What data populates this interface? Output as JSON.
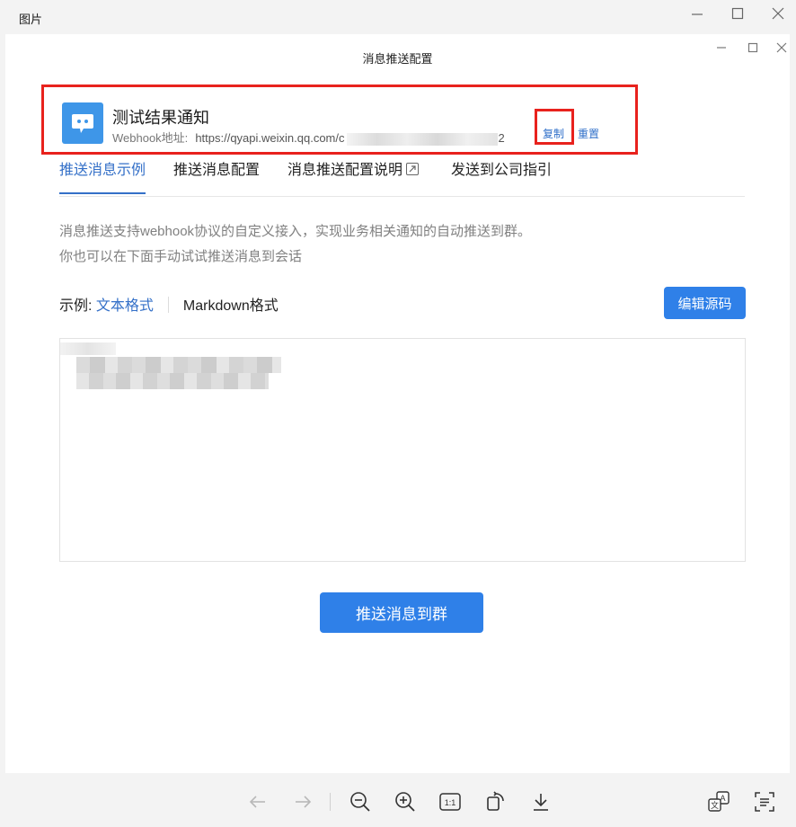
{
  "viewer": {
    "title": "图片",
    "controls": [
      "minimize-icon",
      "maximize-icon",
      "close-icon"
    ]
  },
  "dialog": {
    "title": "消息推送配置",
    "controls": [
      "minimize-icon",
      "maximize-icon",
      "close-icon"
    ]
  },
  "bot": {
    "name": "测试结果通知",
    "webhook_label": "Webhook地址:",
    "webhook_url_prefix": "https://qyapi.weixin.qq.com/c",
    "webhook_url_suffix": "2",
    "copy_label": "复制",
    "reset_label": "重置"
  },
  "tabs": [
    {
      "label": "推送消息示例",
      "active": true
    },
    {
      "label": "推送消息配置",
      "active": false
    },
    {
      "label": "消息推送配置说明",
      "active": false
    },
    {
      "label": "发送到公司指引",
      "active": false
    }
  ],
  "description": {
    "line1": "消息推送支持webhook协议的自定义接入，实现业务相关通知的自动推送到群。",
    "line2": "你也可以在下面手动试试推送消息到会话"
  },
  "example": {
    "label": "示例:",
    "options": [
      "文本格式",
      "Markdown格式"
    ],
    "selected": "文本格式"
  },
  "edit_source_label": "编辑源码",
  "push_button_label": "推送消息到群",
  "colors": {
    "accent": "#2f80e8",
    "link": "#3470c8",
    "highlight": "#e8221d"
  },
  "toolbar": [
    "arrow-left-icon",
    "arrow-right-icon",
    "zoom-out-icon",
    "zoom-in-icon",
    "actual-size-icon",
    "rotate-icon",
    "download-icon",
    "translate-icon",
    "ocr-text-icon"
  ],
  "toolbar_actual_size_label": "1:1"
}
